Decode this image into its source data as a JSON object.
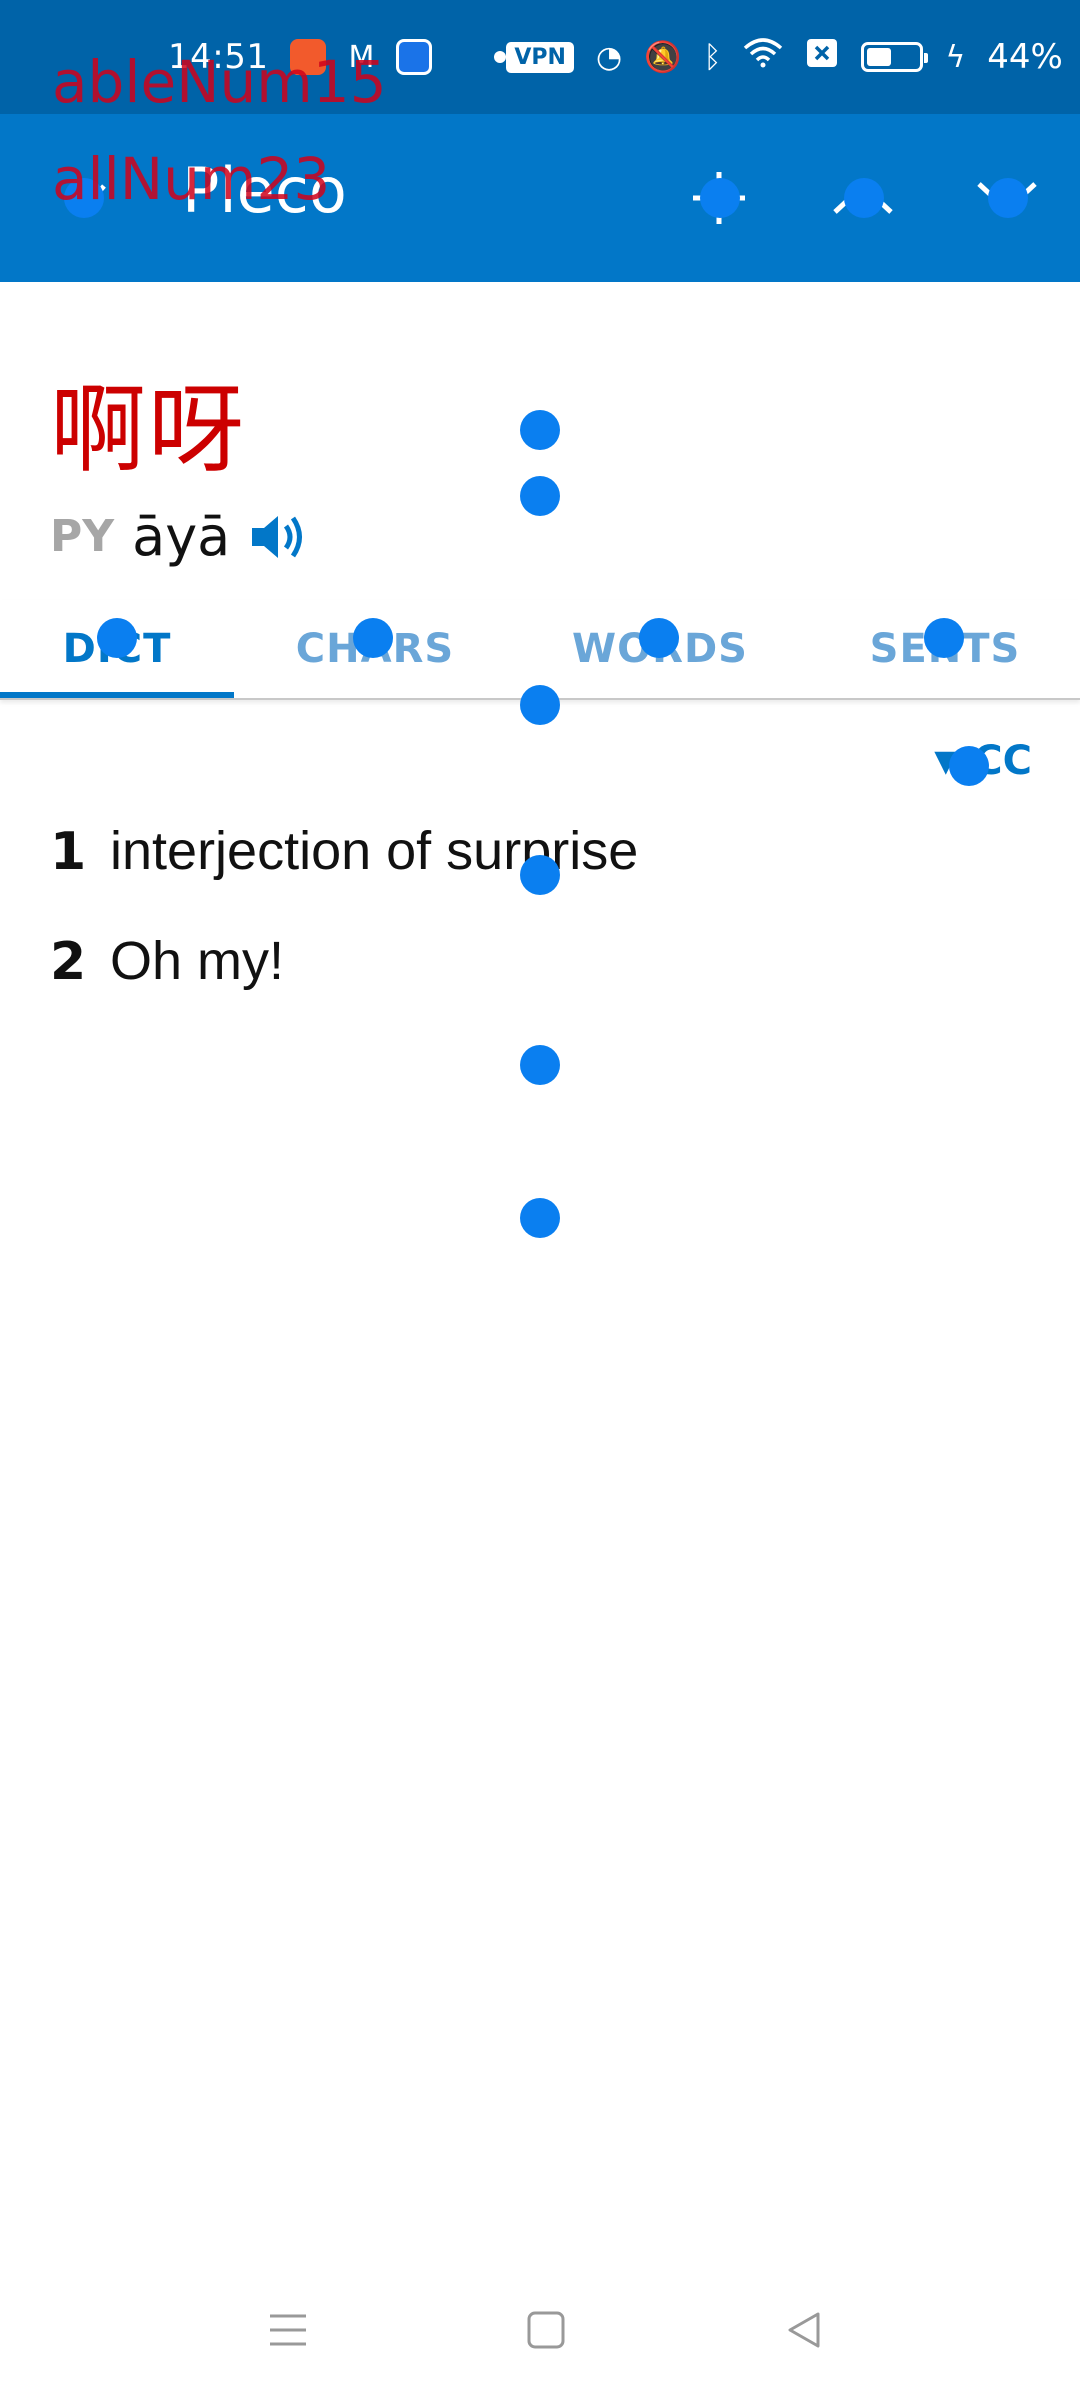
{
  "status_bar": {
    "time": "14:51",
    "vpn_label": "VPN",
    "battery_text": "44%",
    "battery_level": 0.44,
    "icons": [
      "kuaishou-app-icon",
      "gmail-icon",
      "google-app-icon",
      "notification-dot-icon",
      "vpn-icon",
      "speed-icon",
      "mute-icon",
      "bluetooth-icon",
      "wifi-icon",
      "sim-off-icon",
      "battery-icon",
      "charging-icon"
    ]
  },
  "overlay": {
    "label_1": "ableNum15",
    "label_2": "allNum23"
  },
  "app_bar": {
    "title": "Pleco",
    "icons": [
      "drawer-toggle-icon",
      "add-icon",
      "previous-entry-icon",
      "next-entry-icon"
    ]
  },
  "entry": {
    "headword": "啊呀",
    "pinyin_tag": "PY",
    "pinyin": "āyā"
  },
  "tabs": [
    {
      "label": "DICT",
      "active": true
    },
    {
      "label": "CHARS",
      "active": false
    },
    {
      "label": "WORDS",
      "active": false
    },
    {
      "label": "SENTS",
      "active": false
    }
  ],
  "source": {
    "label": "CC"
  },
  "definitions": [
    {
      "num": "1",
      "text": "interjection of surprise"
    },
    {
      "num": "2",
      "text": "Oh my!"
    }
  ],
  "colors": {
    "status_bar": "#0063a8",
    "app_bar": "#0277c8",
    "headword": "#cc0000",
    "accent": "#0277c8",
    "tab_inactive": "#6aa6d8",
    "overlay_dot": "#0a7ff0"
  }
}
